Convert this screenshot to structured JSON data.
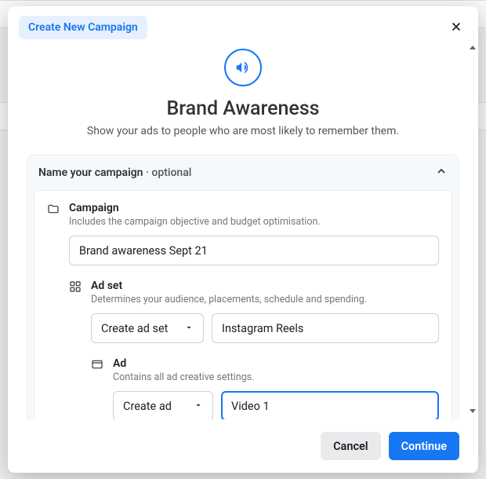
{
  "header": {
    "pill_label": "Create New Campaign"
  },
  "hero": {
    "title": "Brand Awareness",
    "subtitle": "Show your ads to people who are most likely to remember them."
  },
  "section": {
    "title": "Name your campaign",
    "optional_text": " · optional"
  },
  "campaign": {
    "label": "Campaign",
    "desc": "Includes the campaign objective and budget optimisation.",
    "value": "Brand awareness Sept 21"
  },
  "adset": {
    "label": "Ad set",
    "desc": "Determines your audience, placements, schedule and spending.",
    "select_label": "Create ad set",
    "value": "Instagram Reels"
  },
  "ad": {
    "label": "Ad",
    "desc": "Contains all ad creative settings.",
    "select_label": "Create ad",
    "value": "Video 1"
  },
  "footer": {
    "cancel": "Cancel",
    "continue": "Continue"
  }
}
